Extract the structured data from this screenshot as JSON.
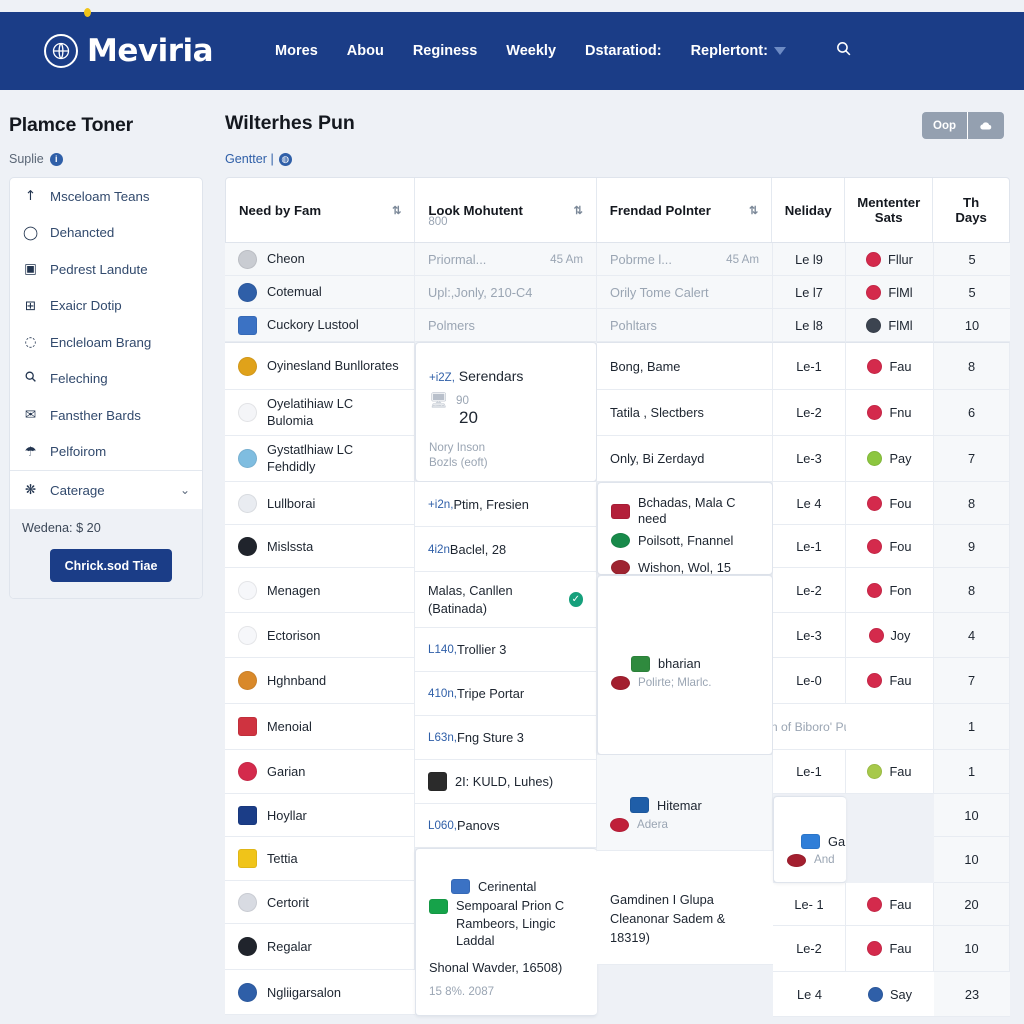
{
  "navbar": {
    "brand": "Meviria",
    "brand_logo_icon": "globe-circle-icon",
    "search_icon": "search-icon",
    "items": [
      {
        "label": "Mores",
        "has_caret": false
      },
      {
        "label": "Abou",
        "has_caret": false
      },
      {
        "label": "Reginess",
        "has_caret": false
      },
      {
        "label": "Weekly",
        "has_caret": false
      },
      {
        "label": "Dstaratiod:",
        "has_caret": false
      },
      {
        "label": "Replertont:",
        "has_caret": true
      }
    ]
  },
  "sidebar": {
    "title": "Plamce Toner",
    "subtitle": "Suplie",
    "subtitle_badge": "i",
    "items": [
      {
        "label": "Msceloam Teans",
        "icon": "arrow-up-icon"
      },
      {
        "label": "Dehancted",
        "icon": "ellipse-icon"
      },
      {
        "label": "Pedrest Landute",
        "icon": "image-box-icon"
      },
      {
        "label": "Exaicr Dotip",
        "icon": "list-card-icon"
      },
      {
        "label": "Encleloam Brang",
        "icon": "circle-outline-icon"
      },
      {
        "label": "Feleching",
        "icon": "search-icon"
      },
      {
        "label": "Fansther Bards",
        "icon": "envelope-icon"
      },
      {
        "label": "Pelfoirom",
        "icon": "umbrella-icon"
      }
    ],
    "category": {
      "label": "Caterage",
      "icon": "cluster-icon",
      "chevron": "chevron-down-icon"
    },
    "price_label": "Wedena: $ 20",
    "cta_label": "Chrick.sod Tiae"
  },
  "main": {
    "title": "Wilterhes Pun",
    "link_label": "Gentter |",
    "link_badge_icon": "globe-icon",
    "segmented": [
      {
        "label": "Oop",
        "icon": ""
      },
      {
        "label": "",
        "icon": "cloud-icon"
      }
    ]
  },
  "table": {
    "columns": [
      {
        "label": "Need by Fam",
        "sub": "",
        "sort": true
      },
      {
        "label": "Look Mohutent",
        "sub": "800",
        "sort": true
      },
      {
        "label": "Frendad Polnter",
        "sub": "",
        "sort": true
      },
      {
        "label": "Neliday",
        "sub": "",
        "sort": false
      },
      {
        "label": "Mententer Sats",
        "sub": "",
        "sort": false
      },
      {
        "label": "Th Days",
        "sub": "",
        "sort": false
      }
    ],
    "sort_icon": "sort-updown-icon",
    "group_a": [
      {
        "flag": "#c9ccd2",
        "shape": "round",
        "name": "Cheon",
        "mid": "Priormal...",
        "mid_right": "45 Am",
        "mid_muted": true,
        "third": "Pobrme l...",
        "third_right": "45 Am",
        "neliday": "Le l9",
        "stat": "Fllur",
        "stat_color": "#d42a4c",
        "days": "5"
      },
      {
        "flag": "#2f5fa8",
        "shape": "round",
        "name": "Cotemual",
        "mid": "Upl:,Jonly, 210-C4",
        "mid_right": "",
        "mid_muted": false,
        "third": "Orily Tome Calert",
        "third_right": "",
        "neliday": "Le l7",
        "stat": "FlMl",
        "stat_color": "#d42a4c",
        "days": "5"
      },
      {
        "flag": "#3b72c4",
        "shape": "square",
        "name": "Cuckory Lustool",
        "mid": "Polmers",
        "mid_right": "",
        "mid_muted": false,
        "third": "Pohltars",
        "third_right": "",
        "neliday": "Le l8",
        "stat": "FlMl",
        "stat_color": "#3c4450",
        "days": "10"
      }
    ],
    "group_b": [
      {
        "flag": "#e0a21a",
        "shape": "round",
        "name": "Oyinesland Bunllorates",
        "neliday": "Le-1",
        "stat": "Fau",
        "stat_color": "#d42a4c",
        "days": "8"
      },
      {
        "flag": "#e8eaef",
        "shape": "round",
        "name": "Oyelatihiaw LC Bulomia",
        "neliday": "Le-2",
        "stat": "Fnu",
        "stat_color": "#d42a4c",
        "days": "6"
      },
      {
        "flag": "#7fbde0",
        "shape": "round",
        "name": "Gystatlhiaw LC Fehdidly",
        "neliday": "Le-3",
        "stat": "Pay",
        "stat_color": "#8cc63f",
        "days": "7"
      },
      {
        "flag": "#e9ecf1",
        "shape": "round",
        "name": "Lullborai",
        "neliday": "Le 4",
        "stat": "Fou",
        "stat_color": "#d42a4c",
        "days": "8"
      },
      {
        "flag": "#20242c",
        "shape": "round",
        "name": "Mislssta",
        "neliday": "Le-1",
        "stat": "Fou",
        "stat_color": "#d42a4c",
        "days": "9"
      },
      {
        "flag": "#f2f3f6",
        "shape": "round",
        "name": "Menagen",
        "neliday": "Le-2",
        "stat": "Fon",
        "stat_color": "#d42a4c",
        "days": "8"
      },
      {
        "flag": "#f2f3f6",
        "shape": "round",
        "name": "Ectorison",
        "neliday": "Le-3",
        "stat": "Joy",
        "stat_color": "#d42a4c",
        "days": "4"
      },
      {
        "flag": "#d9892a",
        "shape": "round",
        "name": "Hghnband",
        "neliday": "Le-0",
        "stat": "Fau",
        "stat_color": "#d42a4c",
        "days": "7"
      },
      {
        "flag": "#cf3340",
        "shape": "square",
        "name": "Menoial",
        "neliday": "| \"En of  Biboro' Pum |",
        "stat": "",
        "stat_color": "",
        "days": "1",
        "span_note": true
      },
      {
        "flag": "#d42a4c",
        "shape": "round",
        "name": "Garian",
        "neliday": "Le-1",
        "stat": "Fau",
        "stat_color": "#a7c94a",
        "days": "1"
      },
      {
        "flag": "#1b3d87",
        "shape": "square",
        "name": "Hoyllar",
        "neliday": "",
        "stat": "Gahial",
        "stat_color": "",
        "days": "10",
        "card_note": true
      },
      {
        "flag": "#f0c419",
        "shape": "square",
        "name": "Tettia",
        "neliday": "",
        "stat": "And",
        "stat_color": "",
        "days": "10",
        "card_note_cont": true
      },
      {
        "flag": "#d8dbe2",
        "shape": "round",
        "name": "Certorit",
        "neliday": "Le- 1",
        "stat": "Fau",
        "stat_color": "#d42a4c",
        "days": "20"
      },
      {
        "flag": "#20242c",
        "shape": "round",
        "name": "Regalar",
        "neliday": "Le-2",
        "stat": "Fau",
        "stat_color": "#d42a4c",
        "days": "10"
      },
      {
        "flag": "#2f5fa8",
        "shape": "round",
        "name": "Ngliigarsalon",
        "neliday": "Le 4",
        "stat": "Say",
        "stat_color": "#2f5fa8",
        "days": "23"
      }
    ],
    "mid_col": [
      {
        "prefix": "+i2Z,",
        "text": " Serendars",
        "type": "head"
      },
      {
        "prefix": "",
        "text": "90",
        "type": "sub-muted"
      },
      {
        "prefix": "",
        "text": "20",
        "type": "big"
      },
      {
        "prefix": "",
        "text": "Nory Inson",
        "type": "muted"
      },
      {
        "prefix": "",
        "text": "Bozls (eoft)",
        "type": "muted"
      },
      {
        "prefix": "+i2n,",
        "text": " Ptim, Fresien",
        "type": "row"
      },
      {
        "prefix": "4i2n",
        "text": " Baclel, 28",
        "type": "row"
      },
      {
        "prefix": "",
        "text": "Malas, Canllen (Batinada)",
        "type": "row-check"
      },
      {
        "prefix": "L140,",
        "text": " Trollier 3",
        "type": "row"
      },
      {
        "prefix": "410n,",
        "text": " Tripe Portar",
        "type": "row"
      },
      {
        "prefix": "L63n,",
        "text": " Fng Sture 3",
        "type": "row"
      },
      {
        "prefix": "",
        "text": "2I: KULD, Luhes)",
        "type": "row-flag"
      },
      {
        "prefix": "L060,",
        "text": " Panovs",
        "type": "row"
      },
      {
        "prefix": "",
        "text": "Cerinental",
        "type": "card-head"
      },
      {
        "prefix": "",
        "text": "Sempoaral Prion C Rambeors, Lingic Laddal",
        "type": "card-body"
      },
      {
        "prefix": "",
        "text": "Shonal Wavder, 16508)",
        "type": "card-body2"
      },
      {
        "prefix": "",
        "text": "15 8%. 2087",
        "type": "card-foot"
      }
    ],
    "third_col": [
      {
        "text": "Bong, Bame",
        "type": "row"
      },
      {
        "text": "Tatila , Slectbers",
        "type": "row"
      },
      {
        "text": "Only, Bi Zerdayd",
        "type": "row"
      },
      {
        "text": "Bchadas, Mala C need",
        "type": "icon-row",
        "icon": "grid-squares-icon"
      },
      {
        "text": "Poilsott, Fnannel",
        "type": "icon-row",
        "icon": "flag-icon"
      },
      {
        "text": "Wishon, Wol, 15",
        "type": "icon-row",
        "icon": "shield-icon"
      },
      {
        "text": "bharian",
        "type": "card-head",
        "icon": "map-icon"
      },
      {
        "text": "Polirte; Mlarlc.",
        "type": "card-muted",
        "icon": "vase-icon"
      },
      {
        "text": "Hitemar",
        "type": "card2-head",
        "icon": "windows-icon"
      },
      {
        "text": "Adera",
        "type": "card2-muted",
        "icon": "flag-red-icon"
      },
      {
        "text": "Gamdinen I Glupa Cleanonar Sadem & 18319)",
        "type": "final"
      }
    ]
  }
}
